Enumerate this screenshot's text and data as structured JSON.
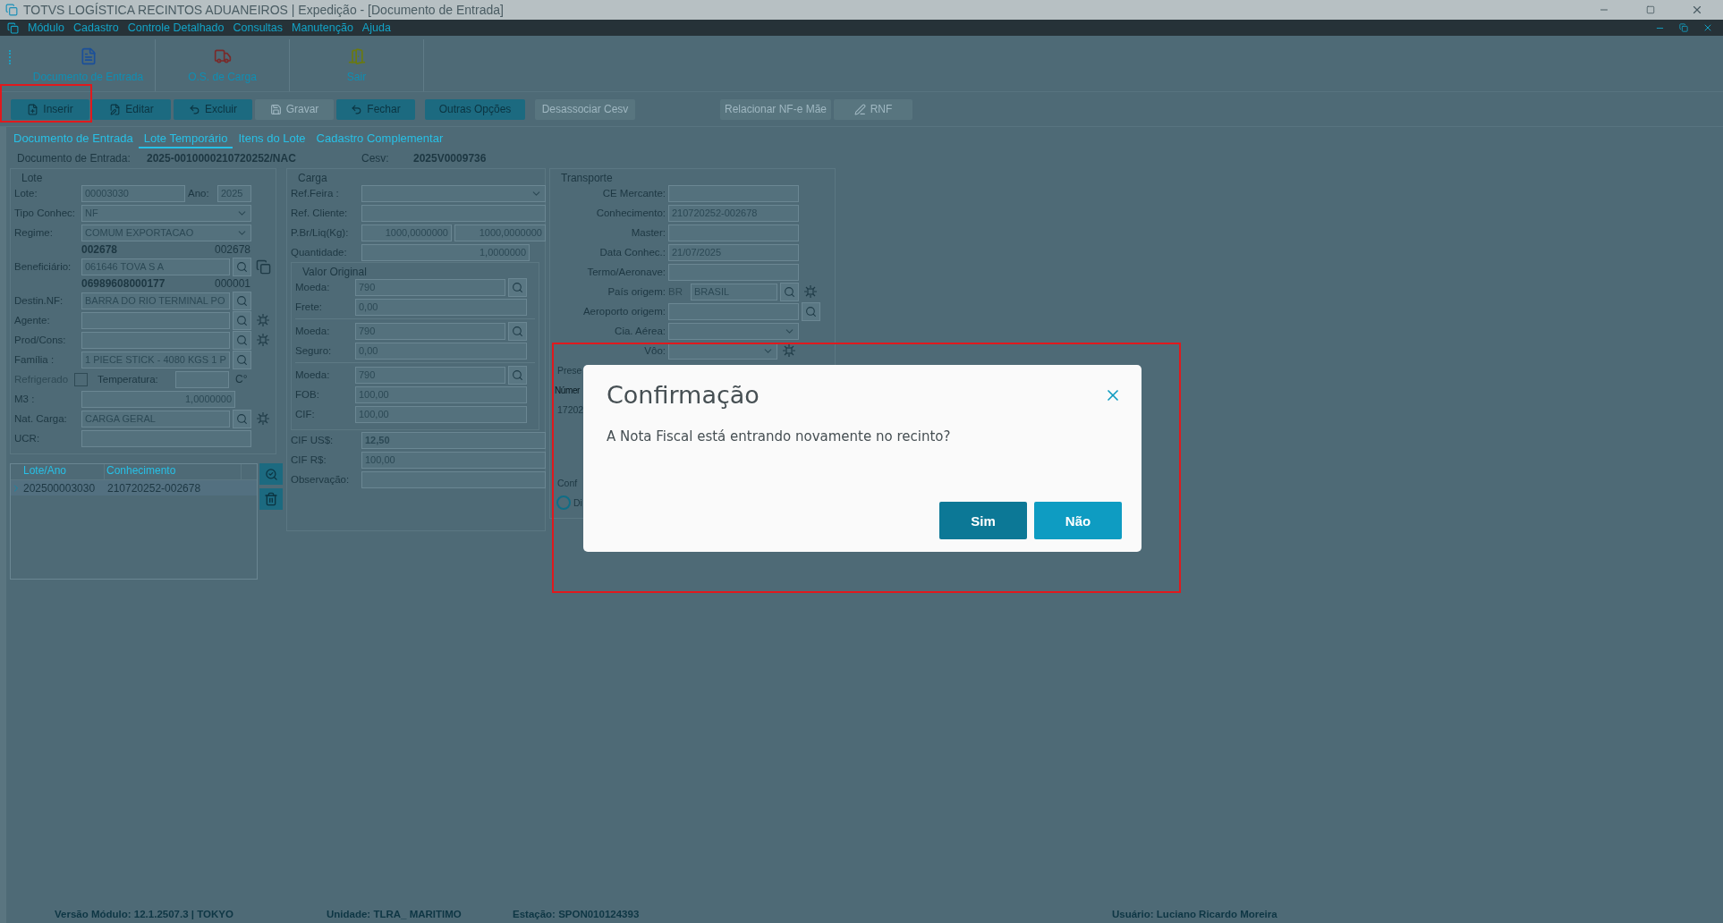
{
  "window": {
    "title": "TOTVS LOGÍSTICA RECINTOS ADUANEIROS | Expedição - [Documento de Entrada]"
  },
  "menu": [
    "Módulo",
    "Cadastro",
    "Controle Detalhado",
    "Consultas",
    "Manutenção",
    "Ajuda"
  ],
  "toolbar": [
    {
      "label": "Documento de Entrada"
    },
    {
      "label": "O.S. de Carga"
    },
    {
      "label": "Sair"
    }
  ],
  "actions": [
    {
      "label": "Inserir",
      "disabled": false
    },
    {
      "label": "Editar",
      "disabled": false
    },
    {
      "label": "Excluir",
      "disabled": false
    },
    {
      "label": "Gravar",
      "disabled": true
    },
    {
      "label": "Fechar",
      "disabled": false
    },
    {
      "label": "Outras Opções",
      "disabled": false
    },
    {
      "label": "Desassociar Cesv",
      "disabled": true
    },
    {
      "label": "Relacionar NF-e Mãe",
      "disabled": true
    },
    {
      "label": "RNF",
      "disabled": true
    }
  ],
  "tabs": [
    {
      "label": "Documento de Entrada",
      "selected": false
    },
    {
      "label": "Lote Temporário",
      "selected": true
    },
    {
      "label": "Itens do Lote",
      "selected": false
    },
    {
      "label": "Cadastro Complementar",
      "selected": false
    }
  ],
  "header": {
    "doc_label": "Documento de Entrada:",
    "doc_value": "2025-0010000210720252/NAC",
    "cesv_label": "Cesv:",
    "cesv_value": "2025V0009736"
  },
  "lote": {
    "title": "Lote",
    "rows": [
      {
        "kind": "pair",
        "label": "Lote:",
        "value": "00003030",
        "label2": "Ano:",
        "value2": "2025"
      },
      {
        "kind": "select",
        "label": "Tipo Conhec:",
        "value": "NF"
      },
      {
        "kind": "select",
        "label": "Regime:",
        "value": "COMUM EXPORTACAO"
      },
      {
        "kind": "codes",
        "value": "002678",
        "value2": "002678"
      },
      {
        "kind": "lookup",
        "label": "Beneficiário:",
        "value": "061646  TOVA S A",
        "copy_button": true
      },
      {
        "kind": "codes",
        "value": "06989608000177",
        "value2": "000001"
      },
      {
        "kind": "lookup",
        "label": "Destin.NF:",
        "value": "BARRA DO RIO TERMINAL PO"
      },
      {
        "kind": "lookup",
        "label": "Agente:",
        "add_button": true
      },
      {
        "kind": "lookup",
        "label": "Prod/Cons:",
        "add_button": true
      },
      {
        "kind": "lookup",
        "label": "Família :",
        "value": "1 PIECE STICK - 4080 KGS 1 P"
      },
      {
        "kind": "checkbox",
        "label": "Refrigerado",
        "checked": false,
        "label2": "Temperatura:",
        "unit": "C°"
      },
      {
        "kind": "number",
        "label": "M3  :",
        "value": "1,0000000"
      },
      {
        "kind": "lookup",
        "label": "Nat. Carga:",
        "value": "CARGA GERAL",
        "add_button": true
      },
      {
        "kind": "text",
        "label": "UCR:"
      }
    ]
  },
  "lots_table": {
    "columns": [
      "Lote/Ano",
      "Conhecimento"
    ],
    "rows": [
      {
        "cells": [
          "202500003030",
          "210720252-002678"
        ],
        "selected": true
      }
    ]
  },
  "carga": {
    "title": "Carga",
    "rows": [
      {
        "kind": "select",
        "label": "Ref.Feira :"
      },
      {
        "kind": "text",
        "label": "Ref. Cliente:"
      },
      {
        "kind": "numbers2",
        "label": "P.Br/Liq(Kg):",
        "value": "1000,0000000",
        "value2": "1000,0000000"
      },
      {
        "kind": "number",
        "label": "Quantidade:",
        "value": "1,0000000"
      }
    ],
    "valor_original": {
      "title": "Valor Original",
      "rows": [
        {
          "kind": "lookup",
          "label": "Moeda:",
          "value": "790"
        },
        {
          "kind": "text",
          "label": "Frete:",
          "value": "0,00"
        },
        {
          "kind": "divider"
        },
        {
          "kind": "lookup",
          "label": "Moeda:",
          "value": "790"
        },
        {
          "kind": "text",
          "label": "Seguro:",
          "value": "0,00"
        },
        {
          "kind": "divider"
        },
        {
          "kind": "lookup",
          "label": "Moeda:",
          "value": "790"
        },
        {
          "kind": "text",
          "label": "FOB:",
          "value": "100,00"
        },
        {
          "kind": "text",
          "label": "CIF:",
          "value": "100,00"
        }
      ]
    },
    "totals": [
      {
        "kind": "text",
        "label": "CIF  US$:",
        "value": "12,50",
        "bold": true
      },
      {
        "kind": "text",
        "label": "CIF  R$:",
        "value": "100,00",
        "bold": false
      },
      {
        "kind": "text",
        "label": "Observação:"
      }
    ]
  },
  "transporte": {
    "title": "Transporte",
    "rows": [
      {
        "kind": "text",
        "label": "CE Mercante:"
      },
      {
        "kind": "text",
        "label": "Conhecimento:",
        "value": "210720252-002678"
      },
      {
        "kind": "text",
        "label": "Master:"
      },
      {
        "kind": "text",
        "label": "Data Conhec.:",
        "value": "21/07/2025"
      },
      {
        "kind": "text",
        "label": "Termo/Aeronave:"
      },
      {
        "kind": "lookup",
        "label": "País origem:",
        "prefix": "BR",
        "value": "BRASIL",
        "add_button": true
      },
      {
        "kind": "lookup_apart",
        "label": "Aeroporto origem:"
      },
      {
        "kind": "select",
        "label": "Cia. Aérea:"
      },
      {
        "kind": "select_short",
        "label": "Vôo:",
        "add_button": true
      }
    ],
    "hidden": {
      "group": "Prese",
      "column": "Númer",
      "cell": "17202",
      "group2": "Conf",
      "radio": "Di"
    }
  },
  "dialog": {
    "title": "Confirmação",
    "message": "A Nota Fiscal está entrando novamente no recinto?",
    "buttons": [
      {
        "label": "Sim",
        "kind": "primary"
      },
      {
        "label": "Não",
        "kind": "secondary"
      }
    ]
  },
  "status_bar": [
    "Versão Módulo:  12.1.2507.3  |  TOKYO",
    "Unidade:  TLRA_ MARITIMO",
    "Estação:  SPON010124393",
    "Usuário: Luciano Ricardo Moreira"
  ]
}
